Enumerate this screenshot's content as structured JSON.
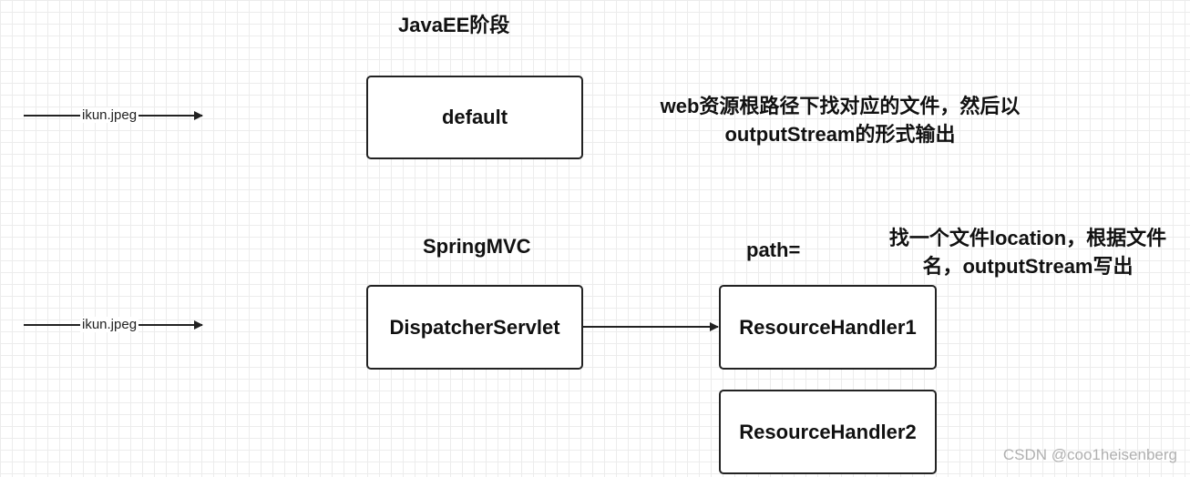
{
  "javaee": {
    "stage_title": "JavaEE阶段",
    "request_label": "ikun.jpeg",
    "default_box": "default",
    "note_line1": "web资源根路径下找对应的文件，然后以",
    "note_line2": "outputStream的形式输出"
  },
  "springmvc": {
    "stage_title": "SpringMVC",
    "request_label": "ikun.jpeg",
    "dispatcher_box": "DispatcherServlet",
    "path_label": "path=",
    "note_line1": "找一个文件location，根据文件",
    "note_line2": "名，outputStream写出",
    "handler1_box": "ResourceHandler1",
    "handler2_box": "ResourceHandler2"
  },
  "watermark": "CSDN @coo1heisenberg"
}
